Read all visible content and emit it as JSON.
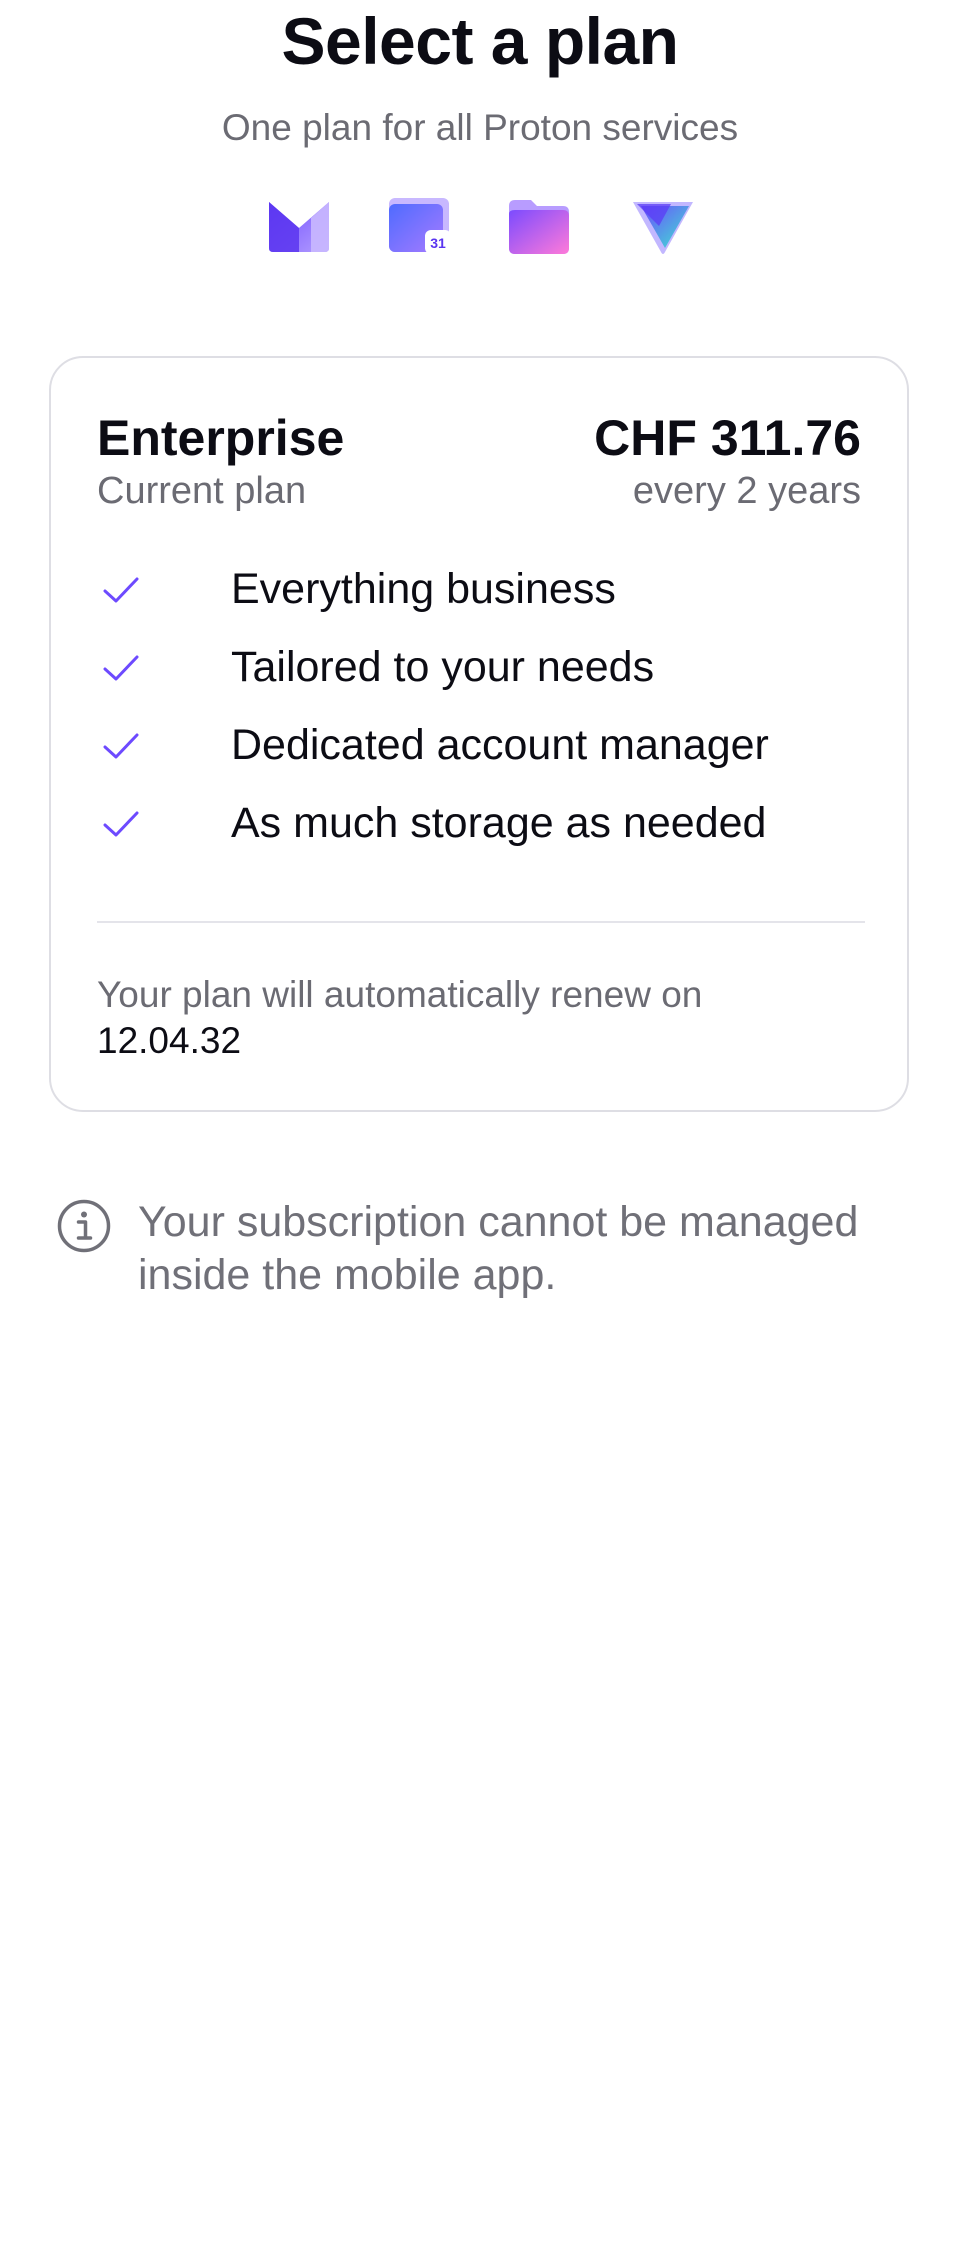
{
  "header": {
    "title": "Select a plan",
    "subtitle": "One plan for all Proton services"
  },
  "apps": [
    {
      "name": "Proton Mail",
      "icon": "mail-icon"
    },
    {
      "name": "Proton Calendar",
      "icon": "calendar-icon",
      "badge": "31"
    },
    {
      "name": "Proton Drive",
      "icon": "drive-icon"
    },
    {
      "name": "Proton VPN",
      "icon": "vpn-icon"
    }
  ],
  "plan": {
    "name": "Enterprise",
    "status": "Current plan",
    "price": "CHF 311.76",
    "cycle": "every 2 years",
    "features": [
      "Everything business",
      "Tailored to your needs",
      "Dedicated account manager",
      "As much storage as needed"
    ],
    "renew_prefix": "Your plan will automatically renew on",
    "renew_date": "12.04.32"
  },
  "notice": {
    "text": "Your subscription cannot be managed inside the mobile app."
  },
  "colors": {
    "accent": "#6d4aff",
    "text_primary": "#0c0c14",
    "text_secondary": "#6b6b73",
    "border": "#dedee4"
  }
}
